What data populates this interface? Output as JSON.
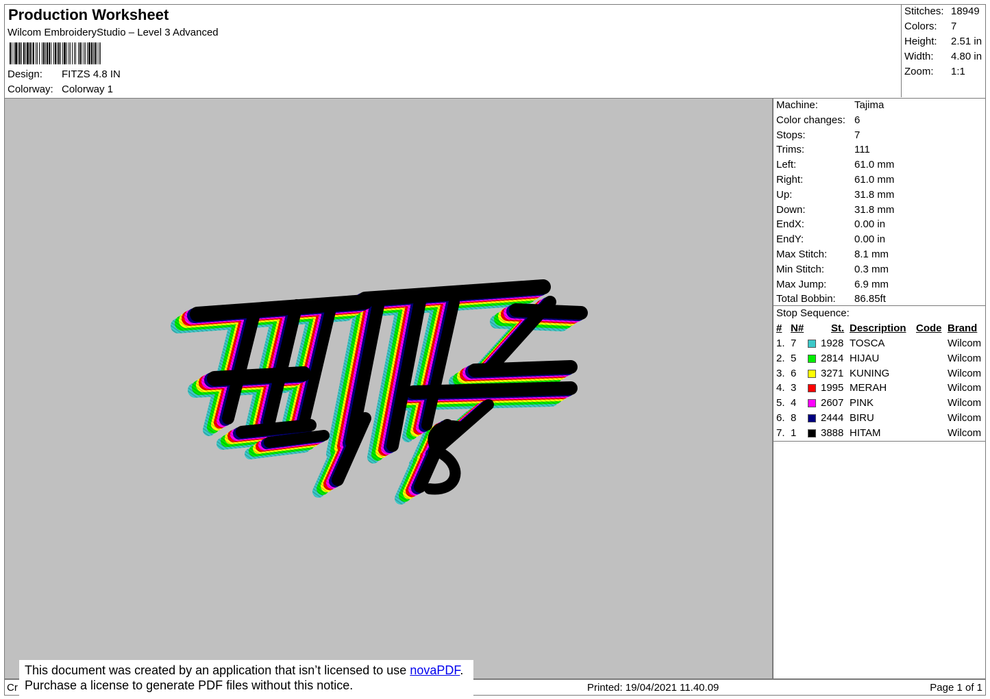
{
  "header": {
    "title": "Production Worksheet",
    "subtitle": "Wilcom EmbroideryStudio – Level 3 Advanced",
    "design_label": "Design:",
    "design_value": "FITZS 4.8 IN",
    "colorway_label": "Colorway:",
    "colorway_value": "Colorway 1"
  },
  "stats": [
    {
      "label": "Stitches:",
      "value": "18949"
    },
    {
      "label": "Colors:",
      "value": "7"
    },
    {
      "label": "Height:",
      "value": "2.51 in"
    },
    {
      "label": "Width:",
      "value": "4.80 in"
    },
    {
      "label": "Zoom:",
      "value": "1:1"
    }
  ],
  "machine_info": [
    {
      "label": "Machine:",
      "value": "Tajima"
    },
    {
      "label": "Color changes:",
      "value": "6"
    },
    {
      "label": "Stops:",
      "value": "7"
    },
    {
      "label": "Trims:",
      "value": "111"
    },
    {
      "label": "Left:",
      "value": "61.0 mm"
    },
    {
      "label": "Right:",
      "value": "61.0 mm"
    },
    {
      "label": "Up:",
      "value": "31.8 mm"
    },
    {
      "label": "Down:",
      "value": "31.8 mm"
    },
    {
      "label": "EndX:",
      "value": "0.00 in"
    },
    {
      "label": "EndY:",
      "value": "0.00 in"
    },
    {
      "label": "Max Stitch:",
      "value": "8.1 mm"
    },
    {
      "label": "Min Stitch:",
      "value": "0.3 mm"
    },
    {
      "label": "Max Jump:",
      "value": "6.9 mm"
    },
    {
      "label": "Total Bobbin:",
      "value": "86.85ft"
    }
  ],
  "stop_sequence": {
    "title": "Stop Sequence:",
    "headers": {
      "num": "#",
      "n": "N#",
      "st": "St.",
      "description": "Description",
      "code": "Code",
      "brand": "Brand"
    },
    "rows": [
      {
        "num": "1.",
        "n": "7",
        "color": "#3cc8c8",
        "st": "1928",
        "description": "TOSCA",
        "code": "",
        "brand": "Wilcom"
      },
      {
        "num": "2.",
        "n": "5",
        "color": "#00ee00",
        "st": "2814",
        "description": "HIJAU",
        "code": "",
        "brand": "Wilcom"
      },
      {
        "num": "3.",
        "n": "6",
        "color": "#ffff00",
        "st": "3271",
        "description": "KUNING",
        "code": "",
        "brand": "Wilcom"
      },
      {
        "num": "4.",
        "n": "3",
        "color": "#ff0000",
        "st": "1995",
        "description": "MERAH",
        "code": "",
        "brand": "Wilcom"
      },
      {
        "num": "5.",
        "n": "4",
        "color": "#ff00ff",
        "st": "2607",
        "description": "PINK",
        "code": "",
        "brand": "Wilcom"
      },
      {
        "num": "6.",
        "n": "8",
        "color": "#000080",
        "st": "2444",
        "description": "BIRU",
        "code": "",
        "brand": "Wilcom"
      },
      {
        "num": "7.",
        "n": "1",
        "color": "#000000",
        "st": "3888",
        "description": "HITAM",
        "code": "",
        "brand": "Wilcom"
      }
    ]
  },
  "footer": {
    "left": "Cr",
    "printed": "Printed: 19/04/2021 11.40.09",
    "page": "Page 1 of 1"
  },
  "notice": {
    "line1_prefix": "This document was created by an application that isn’t licensed to use ",
    "link_text": "novaPDF",
    "line1_suffix": ".",
    "line2": "Purchase a license to generate PDF files without this notice."
  },
  "preview": {
    "background": "#c0c0c0"
  }
}
